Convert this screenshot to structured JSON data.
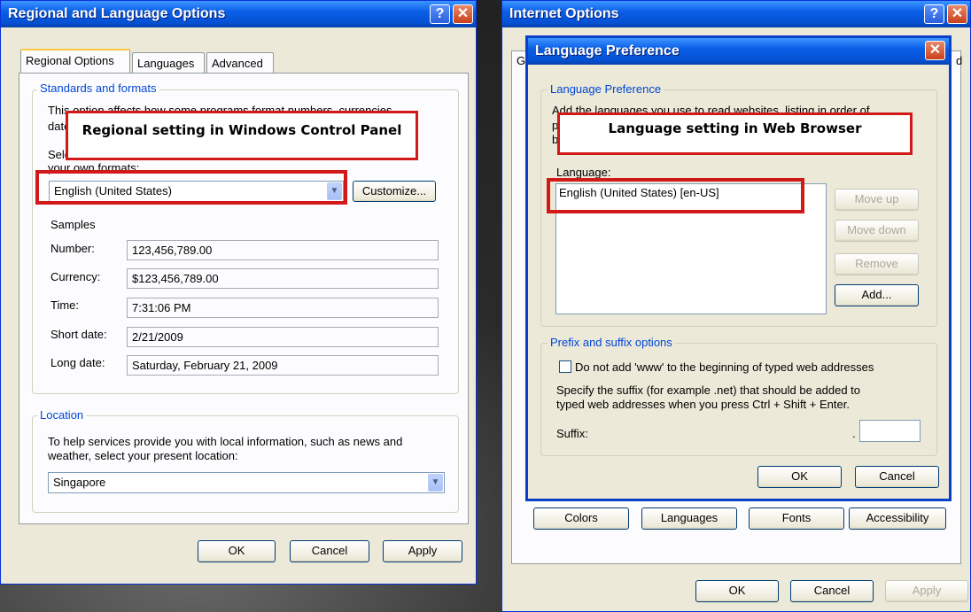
{
  "regional": {
    "title": "Regional and Language Options",
    "help_glyph": "?",
    "close_glyph": "✕",
    "tabs": [
      "Regional Options",
      "Languages",
      "Advanced"
    ],
    "standards_group": "Standards and formats",
    "desc_line1": "This option affects how some programs format numbers, currencies,",
    "desc_line2": "date",
    "select_line1": "Sele",
    "select_line2": "your own formats:",
    "format_value": "English (United States)",
    "customize_label": "Customize...",
    "samples_label": "Samples",
    "samples": [
      {
        "label": "Number:",
        "value": "123,456,789.00"
      },
      {
        "label": "Currency:",
        "value": "$123,456,789.00"
      },
      {
        "label": "Time:",
        "value": "7:31:06 PM"
      },
      {
        "label": "Short date:",
        "value": "2/21/2009"
      },
      {
        "label": "Long date:",
        "value": "Saturday, February 21, 2009"
      }
    ],
    "location_group": "Location",
    "location_desc1": "To help services provide you with local information, such as news and",
    "location_desc2": "weather, select your present location:",
    "location_value": "Singapore",
    "ok": "OK",
    "cancel": "Cancel",
    "apply": "Apply",
    "callout": "Regional setting in Windows Control Panel"
  },
  "internet": {
    "title": "Internet Options",
    "help_glyph": "?",
    "close_glyph": "✕",
    "tab_fragment_left": "G",
    "tab_fragment_right": "d",
    "buttons": [
      "Colors",
      "Languages",
      "Fonts",
      "Accessibility"
    ],
    "ok": "OK",
    "cancel": "Cancel",
    "apply": "Apply"
  },
  "langpref": {
    "title": "Language Preference",
    "close_glyph": "✕",
    "group": "Language Preference",
    "desc1": "Add the languages you use to read websites, listing in order of",
    "desc2": "pre",
    "desc3": "be",
    "language_label": "Language:",
    "languages": [
      "English (United States) [en-US]"
    ],
    "move_up": "Move up",
    "move_down": "Move down",
    "remove": "Remove",
    "add": "Add...",
    "prefix_group": "Prefix and suffix options",
    "checkbox_label": "Do not add 'www' to the beginning of typed web addresses",
    "suffix_desc1": "Specify the suffix (for example .net) that should be added to",
    "suffix_desc2": "typed web addresses when you press Ctrl + Shift + Enter.",
    "suffix_label": "Suffix:",
    "suffix_dot": ".",
    "suffix_value": "",
    "ok": "OK",
    "cancel": "Cancel",
    "callout": "Language setting in Web Browser"
  },
  "colors": {
    "xp_blue": "#0450d2",
    "highlight_red": "#d21919",
    "dialog_bg": "#ece9d8",
    "group_title": "#0046d5"
  }
}
